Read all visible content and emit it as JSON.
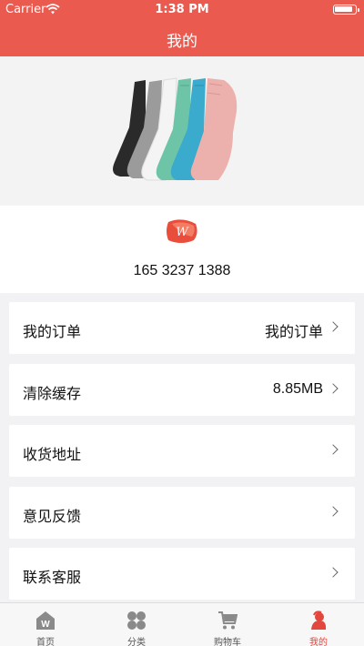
{
  "status_bar": {
    "carrier": "Carrier",
    "time": "1:38 PM"
  },
  "header": {
    "title": "我的"
  },
  "banner": {
    "image": "socks-product-image"
  },
  "profile": {
    "phone": "165 3237 1388",
    "logo_letter": "W"
  },
  "menu": [
    {
      "label": "我的订单",
      "value": "我的订单"
    },
    {
      "label": "清除缓存",
      "value": "8.85MB"
    },
    {
      "label": "收货地址",
      "value": ""
    },
    {
      "label": "意见反馈",
      "value": ""
    },
    {
      "label": "联系客服",
      "value": ""
    }
  ],
  "tabbar": {
    "items": [
      {
        "label": "首页",
        "icon": "home-icon",
        "active": false
      },
      {
        "label": "分类",
        "icon": "category-icon",
        "active": false
      },
      {
        "label": "购物车",
        "icon": "cart-icon",
        "active": false
      },
      {
        "label": "我的",
        "icon": "profile-icon",
        "active": true
      }
    ]
  },
  "colors": {
    "accent": "#ea5a4f",
    "active_tab": "#e2463c",
    "background": "#f2f2f5"
  }
}
